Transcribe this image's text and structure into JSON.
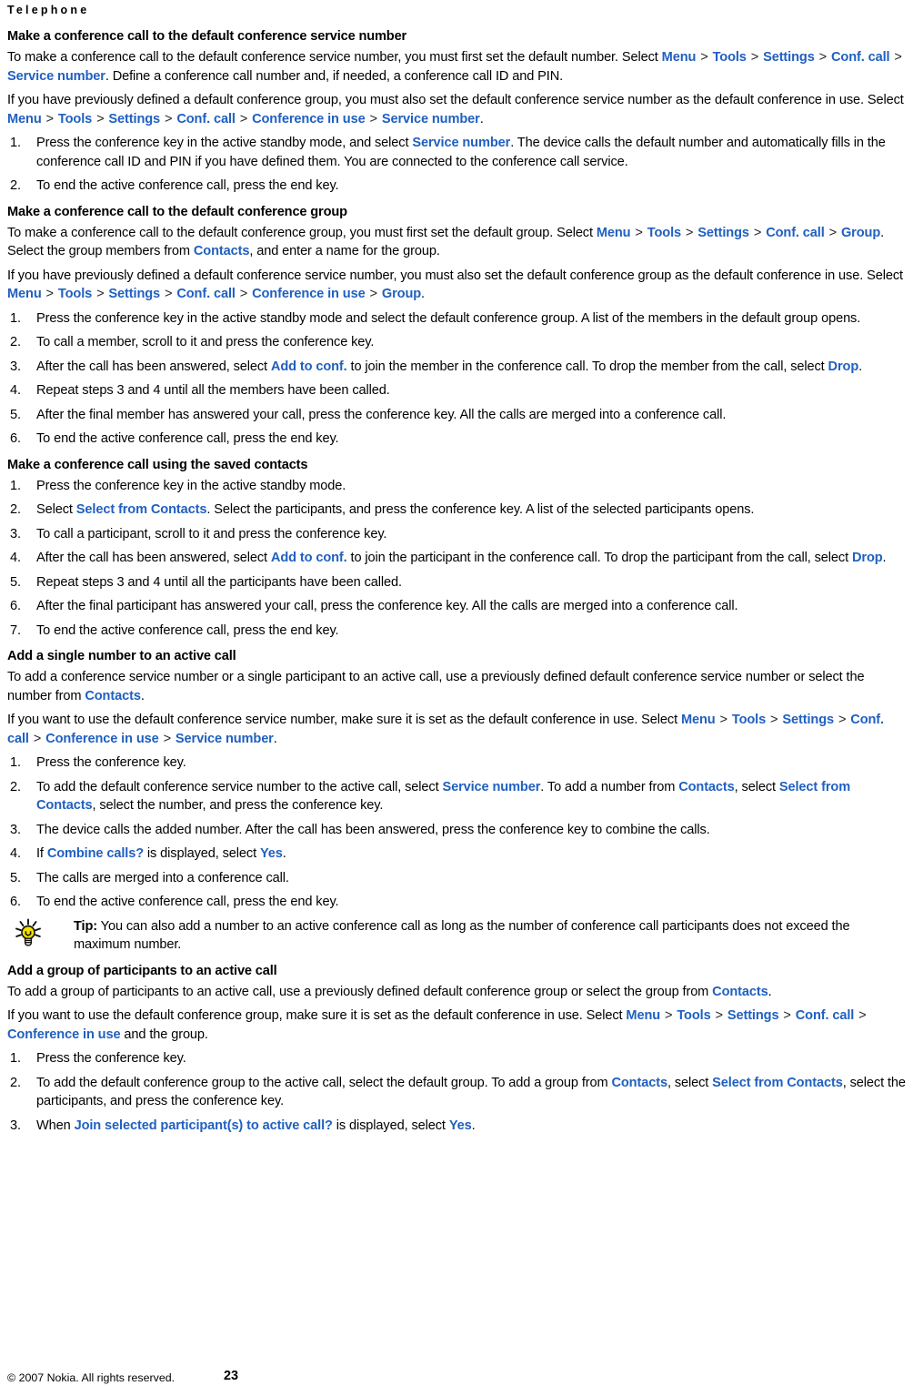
{
  "running_head": "Telephone",
  "colors": {
    "link": "#2060C0",
    "text": "#000000",
    "bulb": "#F5E000"
  },
  "icons": {
    "tip": "lightbulb-icon"
  },
  "sections": [
    {
      "heading": "Make a conference call to the default conference service number",
      "paragraphs": [
        {
          "parts": [
            {
              "t": "To make a conference call to the default conference service number, you must first set the default number. Select "
            },
            {
              "t": "Menu",
              "ui": true
            },
            {
              "t": " > ",
              "sep": true
            },
            {
              "t": "Tools",
              "ui": true
            },
            {
              "t": " > ",
              "sep": true
            },
            {
              "t": "Settings",
              "ui": true
            },
            {
              "t": " > ",
              "sep": true
            },
            {
              "t": "Conf. call",
              "ui": true
            },
            {
              "t": " > ",
              "sep": true
            },
            {
              "t": "Service number",
              "ui": true
            },
            {
              "t": ". Define a conference call number and, if needed, a conference call ID and PIN."
            }
          ]
        },
        {
          "parts": [
            {
              "t": "If you have previously defined a default conference group, you must also set the default conference service number as the default conference in use. Select "
            },
            {
              "t": "Menu",
              "ui": true
            },
            {
              "t": " > ",
              "sep": true
            },
            {
              "t": "Tools",
              "ui": true
            },
            {
              "t": " > ",
              "sep": true
            },
            {
              "t": "Settings",
              "ui": true
            },
            {
              "t": " > ",
              "sep": true
            },
            {
              "t": "Conf. call",
              "ui": true
            },
            {
              "t": " > ",
              "sep": true
            },
            {
              "t": "Conference in use",
              "ui": true
            },
            {
              "t": " > ",
              "sep": true
            },
            {
              "t": "Service number",
              "ui": true
            },
            {
              "t": "."
            }
          ]
        }
      ],
      "steps": [
        {
          "num": "1.",
          "parts": [
            {
              "t": "Press the conference key in the active standby mode, and select "
            },
            {
              "t": "Service number",
              "ui": true
            },
            {
              "t": ". The device calls the default number and automatically fills in the conference call ID and PIN if you have defined them. You are connected to the conference call service."
            }
          ]
        },
        {
          "num": "2.",
          "parts": [
            {
              "t": "To end the active conference call, press the end key."
            }
          ]
        }
      ]
    },
    {
      "heading": "Make a conference call to the default conference group",
      "paragraphs": [
        {
          "parts": [
            {
              "t": "To make a conference call to the default conference group, you must first set the default group. Select "
            },
            {
              "t": "Menu",
              "ui": true
            },
            {
              "t": " > ",
              "sep": true
            },
            {
              "t": "Tools",
              "ui": true
            },
            {
              "t": " > ",
              "sep": true
            },
            {
              "t": "Settings",
              "ui": true
            },
            {
              "t": " > ",
              "sep": true
            },
            {
              "t": "Conf. call",
              "ui": true
            },
            {
              "t": " > ",
              "sep": true
            },
            {
              "t": "Group",
              "ui": true
            },
            {
              "t": ". Select the group members from "
            },
            {
              "t": "Contacts",
              "ui": true
            },
            {
              "t": ", and enter a name for the group."
            }
          ]
        },
        {
          "parts": [
            {
              "t": "If you have previously defined a default conference service number, you must also set the default conference group as the default conference in use. Select "
            },
            {
              "t": "Menu",
              "ui": true
            },
            {
              "t": " > ",
              "sep": true
            },
            {
              "t": "Tools",
              "ui": true
            },
            {
              "t": " > ",
              "sep": true
            },
            {
              "t": "Settings",
              "ui": true
            },
            {
              "t": " > ",
              "sep": true
            },
            {
              "t": "Conf. call",
              "ui": true
            },
            {
              "t": " > ",
              "sep": true
            },
            {
              "t": "Conference in use",
              "ui": true
            },
            {
              "t": " > ",
              "sep": true
            },
            {
              "t": "Group",
              "ui": true
            },
            {
              "t": "."
            }
          ]
        }
      ],
      "steps": [
        {
          "num": "1.",
          "parts": [
            {
              "t": "Press the conference key in the active standby mode and select the default conference group. A list of the members in the default group opens."
            }
          ]
        },
        {
          "num": "2.",
          "parts": [
            {
              "t": "To call a member, scroll to it and press the conference key."
            }
          ]
        },
        {
          "num": "3.",
          "parts": [
            {
              "t": "After the call has been answered, select "
            },
            {
              "t": "Add to conf.",
              "ui": true
            },
            {
              "t": " to join the member in the conference call. To drop the member from the call, select "
            },
            {
              "t": "Drop",
              "ui": true
            },
            {
              "t": "."
            }
          ]
        },
        {
          "num": "4.",
          "parts": [
            {
              "t": "Repeat steps 3 and 4 until all the members have been called."
            }
          ]
        },
        {
          "num": "5.",
          "parts": [
            {
              "t": "After the final member has answered your call, press the conference key. All the calls are merged into a conference call."
            }
          ]
        },
        {
          "num": "6.",
          "parts": [
            {
              "t": "To end the active conference call, press the end key."
            }
          ]
        }
      ]
    },
    {
      "heading": "Make a conference call using the saved contacts",
      "paragraphs": [],
      "steps": [
        {
          "num": "1.",
          "parts": [
            {
              "t": "Press the conference key in the active standby mode."
            }
          ]
        },
        {
          "num": "2.",
          "parts": [
            {
              "t": "Select "
            },
            {
              "t": "Select from Contacts",
              "ui": true
            },
            {
              "t": ". Select the participants, and press the conference key. A list of the selected participants opens."
            }
          ]
        },
        {
          "num": "3.",
          "parts": [
            {
              "t": "To call a participant, scroll to it and press the conference key."
            }
          ]
        },
        {
          "num": "4.",
          "parts": [
            {
              "t": "After the call has been answered, select "
            },
            {
              "t": "Add to conf.",
              "ui": true
            },
            {
              "t": " to join the participant in the conference call. To drop the participant from the call, select "
            },
            {
              "t": "Drop",
              "ui": true
            },
            {
              "t": "."
            }
          ]
        },
        {
          "num": "5.",
          "parts": [
            {
              "t": "Repeat steps 3 and 4 until all the participants have been called."
            }
          ]
        },
        {
          "num": "6.",
          "parts": [
            {
              "t": "After the final participant has answered your call, press the conference key. All the calls are merged into a conference call."
            }
          ]
        },
        {
          "num": "7.",
          "parts": [
            {
              "t": "To end the active conference call, press the end key."
            }
          ]
        }
      ]
    },
    {
      "heading": "Add a single number to an active call",
      "paragraphs": [
        {
          "parts": [
            {
              "t": "To add a conference service number or a single participant to an active call, use a previously defined default conference service number or select the number from "
            },
            {
              "t": "Contacts",
              "ui": true
            },
            {
              "t": "."
            }
          ]
        },
        {
          "parts": [
            {
              "t": "If you want to use the default conference service number, make sure it is set as the default conference in use. Select "
            },
            {
              "t": "Menu",
              "ui": true
            },
            {
              "t": " > ",
              "sep": true
            },
            {
              "t": "Tools",
              "ui": true
            },
            {
              "t": " > ",
              "sep": true
            },
            {
              "t": "Settings",
              "ui": true
            },
            {
              "t": " > ",
              "sep": true
            },
            {
              "t": "Conf. call",
              "ui": true
            },
            {
              "t": " > ",
              "sep": true
            },
            {
              "t": "Conference in use",
              "ui": true
            },
            {
              "t": " > ",
              "sep": true
            },
            {
              "t": "Service number",
              "ui": true
            },
            {
              "t": "."
            }
          ]
        }
      ],
      "steps": [
        {
          "num": "1.",
          "parts": [
            {
              "t": "Press the conference key."
            }
          ]
        },
        {
          "num": "2.",
          "parts": [
            {
              "t": "To add the default conference service number to the active call, select "
            },
            {
              "t": "Service number",
              "ui": true
            },
            {
              "t": ". To add a number from "
            },
            {
              "t": "Contacts",
              "ui": true
            },
            {
              "t": ", select "
            },
            {
              "t": "Select from Contacts",
              "ui": true
            },
            {
              "t": ", select the number, and press the conference key."
            }
          ]
        },
        {
          "num": "3.",
          "parts": [
            {
              "t": "The device calls the added number. After the call has been answered, press the conference key to combine the calls."
            }
          ]
        },
        {
          "num": "4.",
          "parts": [
            {
              "t": "If "
            },
            {
              "t": "Combine calls?",
              "ui": true
            },
            {
              "t": " is displayed, select "
            },
            {
              "t": "Yes",
              "ui": true
            },
            {
              "t": "."
            }
          ]
        },
        {
          "num": "5.",
          "parts": [
            {
              "t": "The calls are merged into a conference call."
            }
          ]
        },
        {
          "num": "6.",
          "parts": [
            {
              "t": "To end the active conference call, press the end key."
            }
          ]
        }
      ],
      "tip": {
        "label": "Tip:",
        "text": " You can also add a number to an active conference call as long as the number of conference call participants does not exceed the maximum number."
      }
    },
    {
      "heading": "Add a group of participants to an active call",
      "paragraphs": [
        {
          "parts": [
            {
              "t": "To add a group of participants to an active call, use a previously defined default conference group or select the group from "
            },
            {
              "t": "Contacts",
              "ui": true
            },
            {
              "t": "."
            }
          ]
        },
        {
          "parts": [
            {
              "t": "If you want to use the default conference group, make sure it is set as the default conference in use. Select "
            },
            {
              "t": "Menu",
              "ui": true
            },
            {
              "t": " > ",
              "sep": true
            },
            {
              "t": "Tools",
              "ui": true
            },
            {
              "t": " > ",
              "sep": true
            },
            {
              "t": "Settings",
              "ui": true
            },
            {
              "t": " > ",
              "sep": true
            },
            {
              "t": "Conf. call",
              "ui": true
            },
            {
              "t": " > ",
              "sep": true
            },
            {
              "t": "Conference in use",
              "ui": true
            },
            {
              "t": " and the group."
            }
          ]
        }
      ],
      "steps": [
        {
          "num": "1.",
          "parts": [
            {
              "t": "Press the conference key."
            }
          ]
        },
        {
          "num": "2.",
          "parts": [
            {
              "t": "To add the default conference group to the active call, select the default group. To add a group from "
            },
            {
              "t": "Contacts",
              "ui": true
            },
            {
              "t": ", select "
            },
            {
              "t": "Select from Contacts",
              "ui": true
            },
            {
              "t": ", select the participants, and press the conference key."
            }
          ]
        },
        {
          "num": "3.",
          "parts": [
            {
              "t": "When "
            },
            {
              "t": "Join selected participant(s) to active call?",
              "ui": true
            },
            {
              "t": " is displayed, select "
            },
            {
              "t": "Yes",
              "ui": true
            },
            {
              "t": "."
            }
          ]
        }
      ]
    }
  ],
  "footer": {
    "copyright": "© 2007 Nokia. All rights reserved.",
    "page_number": "23"
  }
}
